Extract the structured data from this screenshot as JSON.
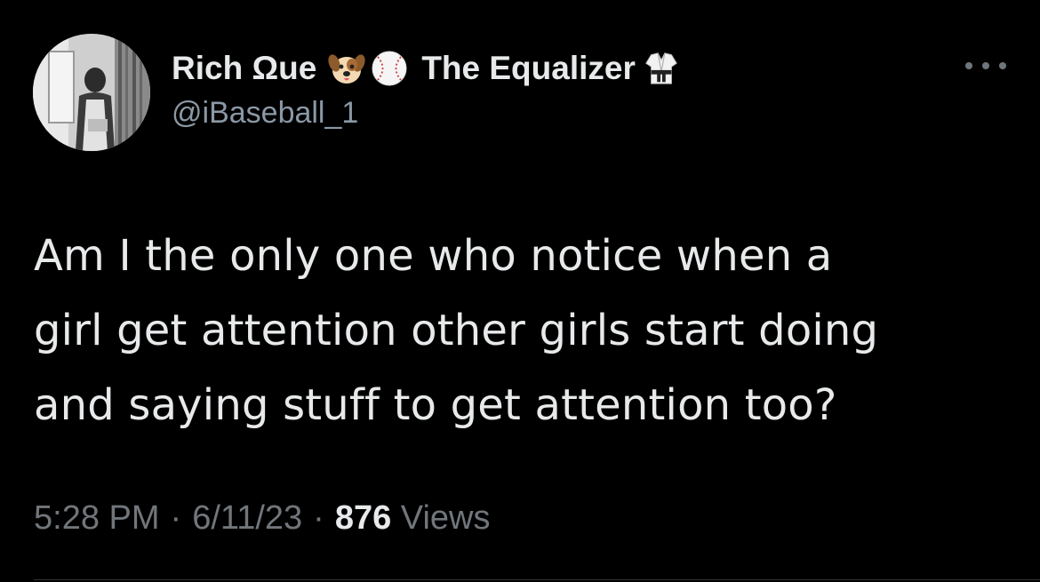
{
  "author": {
    "name_part1": "Rich Ωue",
    "name_part2": "The Equalizer",
    "handle": "@iBaseball_1",
    "emojis": [
      "dog-face-icon",
      "baseball-icon",
      "martial-arts-uniform-icon"
    ]
  },
  "tweet": {
    "lines": [
      "Am I the only one who notice when a",
      "girl get attention other girls start doing",
      "and saying stuff to get attention too?"
    ]
  },
  "meta": {
    "time": "5:28 PM",
    "separator": "·",
    "date": "6/11/23",
    "views_count": "876",
    "views_label": "Views"
  },
  "colors": {
    "background": "#000000",
    "primary_text": "#e7e9ea",
    "secondary_text": "#71767b"
  }
}
